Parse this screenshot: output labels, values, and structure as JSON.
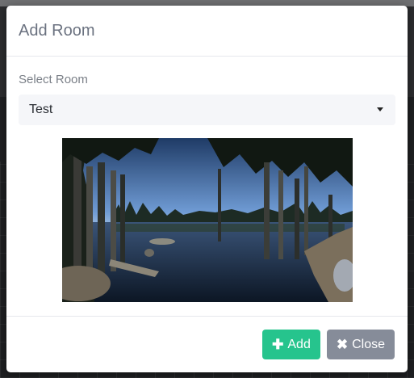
{
  "modal": {
    "title": "Add Room",
    "field_label": "Select Room",
    "select": {
      "value": "Test"
    },
    "preview": {
      "alt": "panorama-lake-forest"
    },
    "buttons": {
      "add": {
        "label": "Add",
        "icon": "plus-icon"
      },
      "close": {
        "label": "Close",
        "icon": "times-icon"
      }
    }
  },
  "colors": {
    "add_button": "#26c48d",
    "close_button": "#868c99",
    "title_text": "#6b7280"
  }
}
